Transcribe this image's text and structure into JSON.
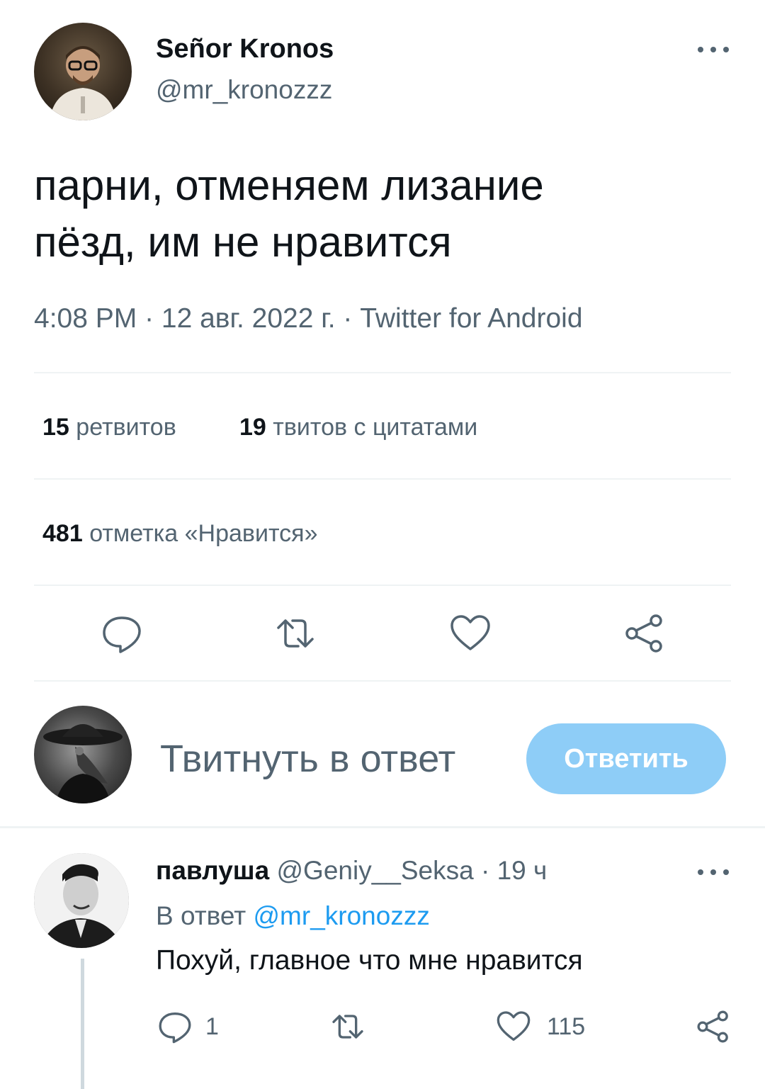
{
  "tweet": {
    "display_name": "Señor Kronos",
    "handle": "@mr_kronozzz",
    "text": "парни, отменяем лизание\nпёзд, им не нравится",
    "meta": "4:08 PM · 12 авг. 2022 г. · Twitter for Android"
  },
  "stats": {
    "retweets_count": "15",
    "retweets_label": "ретвитов",
    "quotes_count": "19",
    "quotes_label": "твитов с цитатами",
    "likes_count": "481",
    "likes_label": "отметка «Нравится»"
  },
  "actions": {
    "icons": [
      "reply-icon",
      "retweet-icon",
      "like-icon",
      "share-icon"
    ]
  },
  "compose": {
    "placeholder": "Твитнуть в ответ",
    "button_label": "Ответить",
    "button_color": "#8ecdf7"
  },
  "reply": {
    "display_name": "павлуша",
    "handle": "@Geniy__Seksa",
    "separator": "·",
    "time": "19 ч",
    "reply_to_prefix": "В ответ",
    "reply_to_mention": "@mr_kronozzz",
    "text": "Похуй, главное что мне нравится",
    "reply_count": "1",
    "like_count": "115"
  },
  "colors": {
    "primary_text": "#0f1419",
    "secondary_text": "#536471",
    "link": "#1d9bf0",
    "divider": "#eff3f4"
  }
}
